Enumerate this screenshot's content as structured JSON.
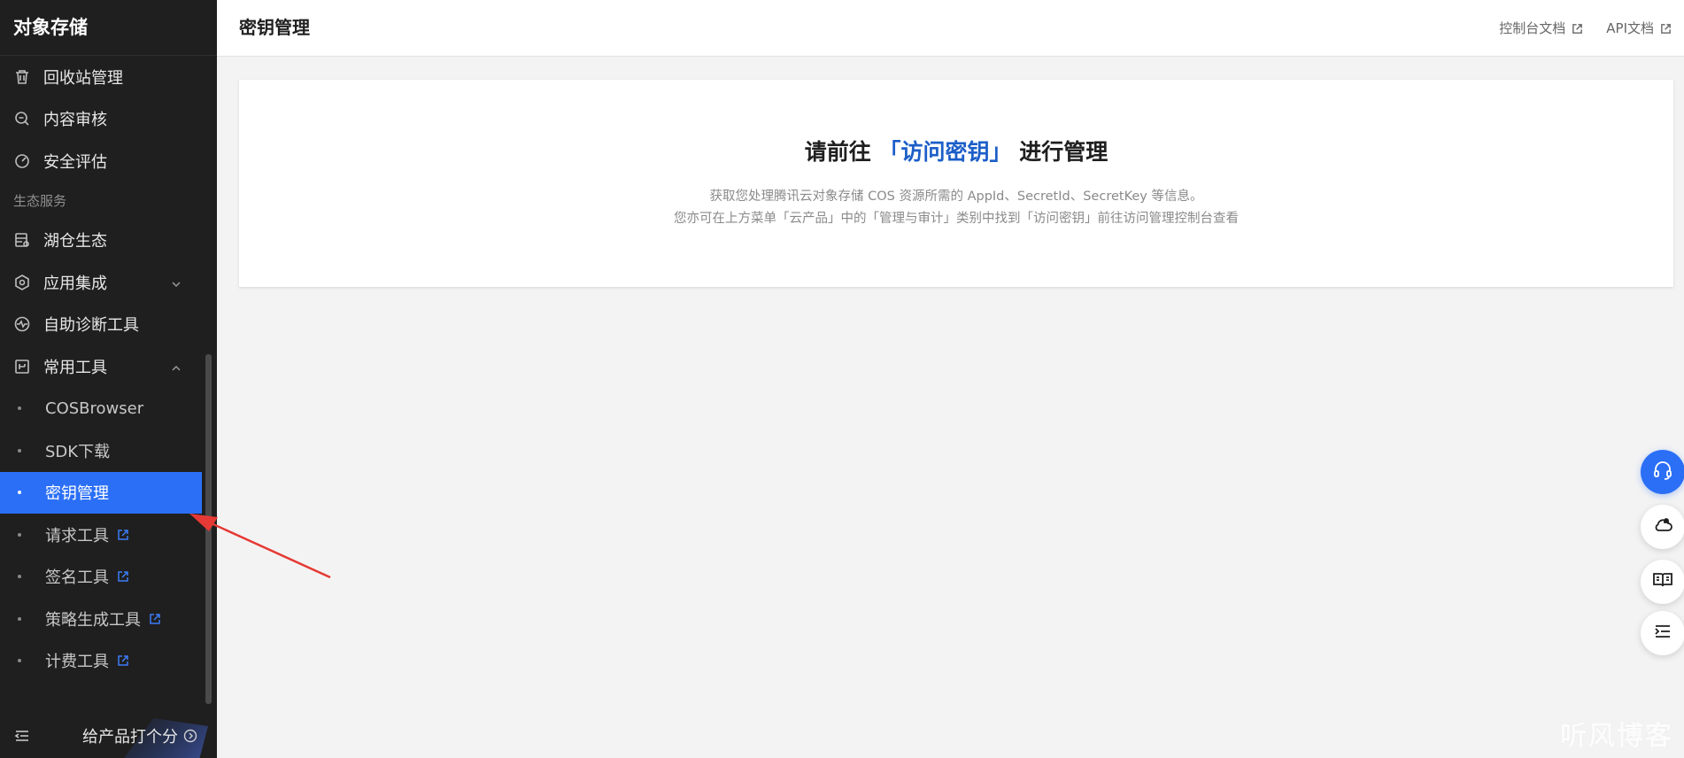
{
  "sidebar": {
    "title": "对象存储",
    "items_top": [
      {
        "label": "回收站管理",
        "icon": "trash-icon"
      },
      {
        "label": "内容审核",
        "icon": "search-review-icon"
      },
      {
        "label": "安全评估",
        "icon": "gauge-icon"
      }
    ],
    "group_label": "生态服务",
    "items_eco": [
      {
        "label": "湖仓生态",
        "icon": "database-icon"
      },
      {
        "label": "应用集成",
        "icon": "cube-icon"
      },
      {
        "label": "自助诊断工具",
        "icon": "pulse-icon"
      },
      {
        "label": "常用工具",
        "icon": "toolbox-icon"
      }
    ],
    "sub_items": [
      {
        "label": "COSBrowser"
      },
      {
        "label": "SDK下载"
      },
      {
        "label": "密钥管理"
      },
      {
        "label": "请求工具"
      },
      {
        "label": "签名工具"
      },
      {
        "label": "策略生成工具"
      },
      {
        "label": "计费工具"
      }
    ],
    "footer_rate": "给产品打个分"
  },
  "header": {
    "title": "密钥管理",
    "links": {
      "console_docs": "控制台文档",
      "api_docs": "API文档"
    }
  },
  "card": {
    "heading_prefix": "请前往",
    "heading_link": "「访问密钥」",
    "heading_suffix": "进行管理",
    "desc_line1": "获取您处理腾讯云对象存储 COS 资源所需的 AppId、SecretId、SecretKey 等信息。",
    "desc_line2": "您亦可在上方菜单「云产品」中的「管理与审计」类别中找到「访问密钥」前往访问管理控制台查看"
  },
  "watermark": {
    "text": "听风博客"
  },
  "colors": {
    "sidebar_bg": "#1f1f1f",
    "accent": "#2b6ff6",
    "link": "#1c5ec8",
    "annotation_arrow": "#e53935"
  }
}
